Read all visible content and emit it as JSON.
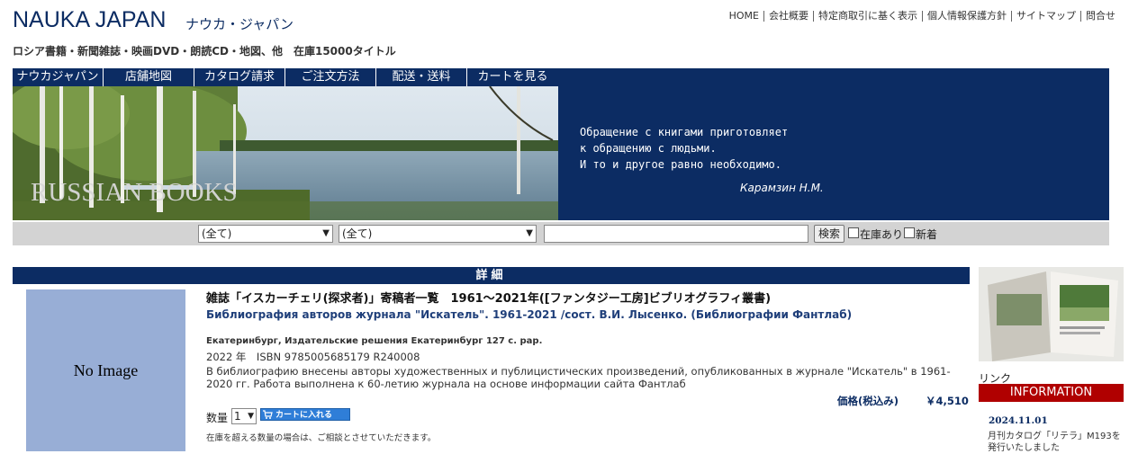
{
  "header": {
    "logo": "NAUKA JAPAN",
    "logo_kana": "ナウカ・ジャパン",
    "tagline": "ロシア書籍・新聞雑誌・映画DVD・朗読CD・地図、他　在庫15000タイトル",
    "top_links": [
      "HOME",
      "会社概要",
      "特定商取引に基く表示",
      "個人情報保護方針",
      "サイトマップ",
      "問合せ"
    ]
  },
  "nav": [
    "ナウカジャパン",
    "店舗地図",
    "カタログ請求",
    "ご注文方法",
    "配送・送料",
    "カートを見る"
  ],
  "banner": {
    "photo_text": "RUSSIAN BOOKS",
    "quote_lines": [
      "Обращение с книгами приготовляет",
      "к обращению с людьми.",
      "И то и другое равно необходимо."
    ],
    "quote_author": "Карамзин Н.М."
  },
  "search": {
    "category1": "(全て)",
    "category2": "(全て)",
    "keyword": "",
    "button": "検索",
    "in_stock_label": "在庫あり",
    "new_label": "新着"
  },
  "detail": {
    "heading": "詳細",
    "no_image": "No Image",
    "title_ja": "雑誌「イスカーチェリ(探求者)」寄稿者一覧　1961～2021年([ファンタジー工房]ビブリオグラフィ叢書)",
    "title_ru": "Библиография авторов журнала \"Искатель\". 1961-2021 /сост. В.И. Лысенко. (Библиографии Фантлаб)",
    "publisher": "Екатеринбург, Издательские решения Екатеринбург 127 с. pap.",
    "isbn_line": "2022 年　ISBN  9785005685179   R240008",
    "description": "В библиографию внесены авторы художественных и публицистических произведений, опубликованных в журнале \"Искатель\" в 1961-2020 гг. Работа выполнена к 60-летию журнала на основе информации сайта Фантлаб",
    "price_label": "価格(税込み)",
    "price_value": "￥4,510",
    "qty_label": "数量",
    "qty_value": "1",
    "cart_button": "カートに入れる",
    "note": "在庫を超える数量の場合は、ご相談とさせていただきます。"
  },
  "sidebar": {
    "link_label": "リンク",
    "info_heading": "INFORMATION",
    "info_date": "2024.11.01",
    "info_text": "月刊カタログ「リテラ」M193を発行いたしました"
  },
  "colors": {
    "navy": "#0c2c63",
    "info_red": "#b00000",
    "noimage_bg": "#98aed6",
    "search_bar": "#d3d3d3"
  }
}
